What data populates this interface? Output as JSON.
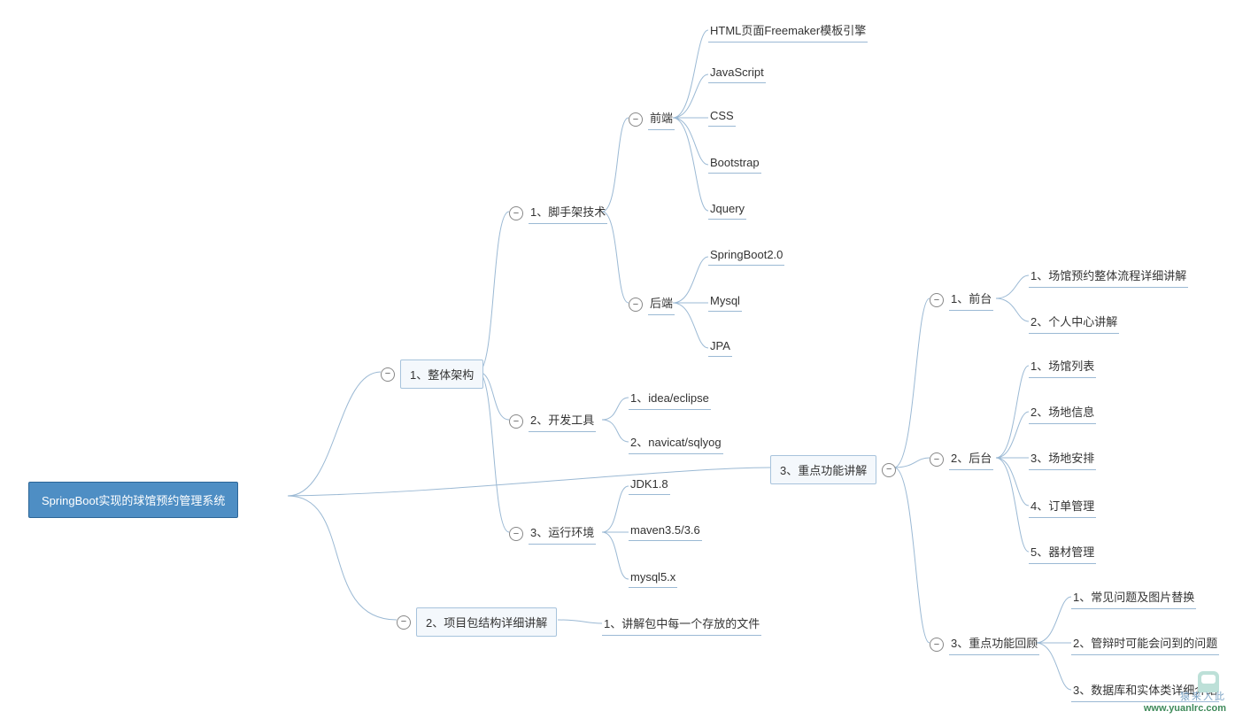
{
  "root": "SpringBoot实现的球馆预约管理系统",
  "branches": {
    "b1": "1、整体架构",
    "b2": "2、项目包结构详细讲解",
    "b3": "3、重点功能讲解"
  },
  "b1_children": {
    "c1": "1、脚手架技术",
    "c2": "2、开发工具",
    "c3": "3、运行环境"
  },
  "b1_c1_children": {
    "frontend": "前端",
    "backend": "后端"
  },
  "frontend_items": {
    "0": "HTML页面Freemaker模板引擎",
    "1": "JavaScript",
    "2": "CSS",
    "3": "Bootstrap",
    "4": "Jquery"
  },
  "backend_items": {
    "0": "SpringBoot2.0",
    "1": "Mysql",
    "2": "JPA"
  },
  "b1_c2_items": {
    "0": "1、idea/eclipse",
    "1": "2、navicat/sqlyog"
  },
  "b1_c3_items": {
    "0": "JDK1.8",
    "1": "maven3.5/3.6",
    "2": "mysql5.x"
  },
  "b2_items": {
    "0": "1、讲解包中每一个存放的文件"
  },
  "b3_children": {
    "c1": "1、前台",
    "c2": "2、后台",
    "c3": "3、重点功能回顾"
  },
  "b3_c1_items": {
    "0": "1、场馆预约整体流程详细讲解",
    "1": "2、个人中心讲解"
  },
  "b3_c2_items": {
    "0": "1、场馆列表",
    "1": "2、场地信息",
    "2": "3、场地安排",
    "3": "4、订单管理",
    "4": "5、器材管理"
  },
  "b3_c3_items": {
    "0": "1、常见问题及图片替换",
    "1": "2、管辩时可能会问到的问题",
    "2": "3、数据库和实体类详细介绍"
  },
  "watermark": {
    "line1": "猿来入此",
    "line2": "www.yuanlrc.com"
  },
  "icon": {
    "minus": "−"
  }
}
